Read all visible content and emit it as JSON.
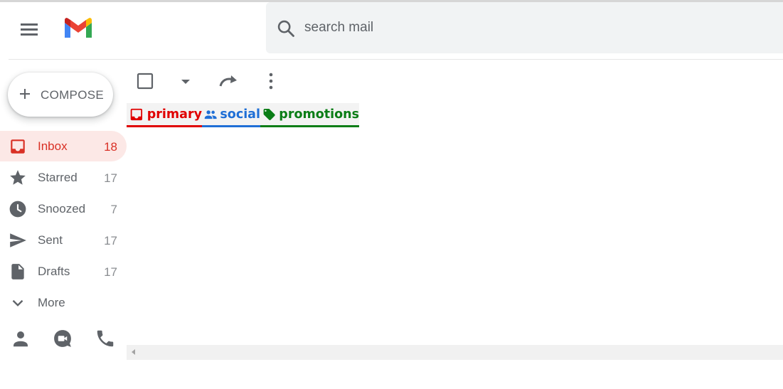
{
  "header": {
    "menu_icon": "hamburger-menu-icon",
    "logo": "gmail-logo",
    "search": {
      "placeholder": "search mail",
      "value": ""
    }
  },
  "compose": {
    "label": "COMPOSE",
    "icon": "plus-icon"
  },
  "sidebar": {
    "items": [
      {
        "label": "Inbox",
        "count": "18",
        "icon": "inbox-icon",
        "active": true
      },
      {
        "label": "Starred",
        "count": "17",
        "icon": "star-icon",
        "active": false
      },
      {
        "label": "Snoozed",
        "count": "7",
        "icon": "clock-icon",
        "active": false
      },
      {
        "label": "Sent",
        "count": "17",
        "icon": "send-icon",
        "active": false
      },
      {
        "label": "Drafts",
        "count": "17",
        "icon": "draft-icon",
        "active": false
      },
      {
        "label": "More",
        "count": "",
        "icon": "chevron-down-icon",
        "active": false
      }
    ],
    "bottom_icons": [
      "person-icon",
      "video-call-icon",
      "phone-icon"
    ]
  },
  "toolbar": {
    "icons": [
      "checkbox-icon",
      "dropdown-arrow-icon",
      "refresh-icon",
      "more-vert-icon"
    ]
  },
  "tabs": [
    {
      "label": "primary",
      "icon": "inbox-icon",
      "color": "#e00000"
    },
    {
      "label": "social",
      "icon": "people-icon",
      "color": "#1f6fd6"
    },
    {
      "label": "promotions",
      "icon": "tag-icon",
      "color": "#0a7d16"
    }
  ],
  "colors": {
    "active_bg": "#fce8e6",
    "active_text": "#d93025",
    "icon_gray": "#5f6368"
  }
}
